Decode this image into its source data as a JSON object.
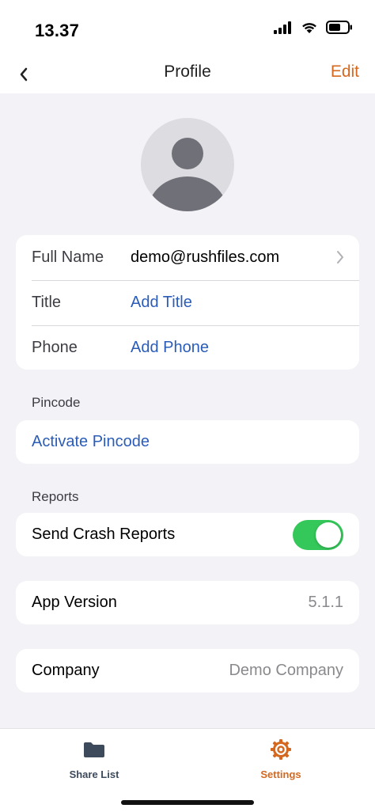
{
  "status_bar": {
    "time": "13.37"
  },
  "nav": {
    "back_icon": "chevron-left-icon",
    "title": "Profile",
    "edit_label": "Edit",
    "accent_color": "#d4681f"
  },
  "profile": {
    "rows": [
      {
        "label": "Full Name",
        "value": "demo@rushfiles.com"
      },
      {
        "label": "Title",
        "value": "Add Title"
      },
      {
        "label": "Phone",
        "value": "Add Phone"
      }
    ]
  },
  "pincode": {
    "header": "Pincode",
    "action_label": "Activate Pincode"
  },
  "reports": {
    "header": "Reports",
    "crash_label": "Send Crash Reports",
    "crash_enabled": true
  },
  "app_version": {
    "label": "App Version",
    "value": "5.1.1"
  },
  "company": {
    "label": "Company",
    "value": "Demo Company"
  },
  "tabs": [
    {
      "label": "Share List",
      "icon": "folder-icon",
      "active": false
    },
    {
      "label": "Settings",
      "icon": "gear-icon",
      "active": true
    }
  ],
  "colors": {
    "link": "#2a5cb8",
    "toggle_on": "#34c759",
    "tab_inactive": "#3d4a5c"
  }
}
